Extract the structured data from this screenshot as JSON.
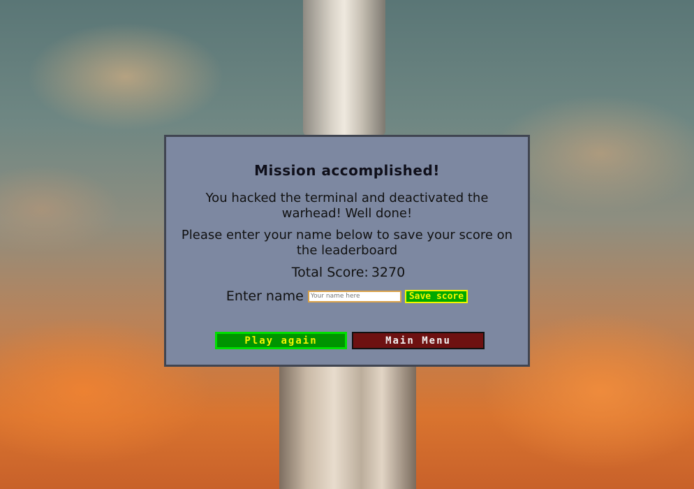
{
  "dialog": {
    "title": "Mission accomplished!",
    "message": "You hacked the terminal and deactivated the warhead! Well done!",
    "prompt": "Please enter your name below to save your score on the leaderboard",
    "score_label": "Total Score:",
    "score_value": "3270",
    "name_label": "Enter name",
    "name_placeholder": "Your name here",
    "save_label": "Save score",
    "play_again_label": "Play again",
    "main_menu_label": "Main Menu"
  },
  "colors": {
    "panel": "#7d88a1",
    "save_button": "#00a800",
    "play_button": "#009400",
    "menu_button": "#6e1111",
    "button_text": "#f5f500"
  }
}
